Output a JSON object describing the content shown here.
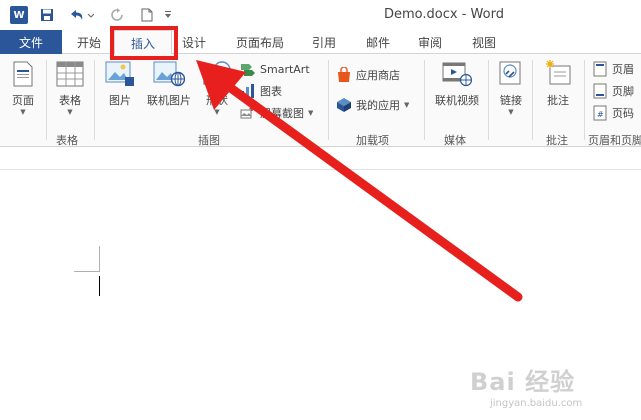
{
  "window": {
    "title": "Demo.docx - Word",
    "app_icon_letter": "W"
  },
  "quick_access": {
    "save": "save-icon",
    "undo": "undo-icon",
    "redo": "redo-icon",
    "new": "new-document-icon",
    "customize": "customize-caret-icon"
  },
  "tabs": {
    "file": "文件",
    "items": [
      "开始",
      "插入",
      "设计",
      "页面布局",
      "引用",
      "邮件",
      "审阅",
      "视图"
    ],
    "active": "插入"
  },
  "ribbon": {
    "groups": {
      "pages": "",
      "tables": "表格",
      "illustrations": "插图",
      "addins": "加载项",
      "media": "媒体",
      "links": "",
      "comments": "批注",
      "header_footer": "页眉和页脚"
    },
    "buttons": {
      "page": "页面",
      "table": "表格",
      "pictures": "图片",
      "online_pictures": "联机图片",
      "shapes": "形状",
      "smartart": "SmartArt",
      "chart": "图表",
      "screenshot": "屏幕截图",
      "store": "应用商店",
      "my_apps": "我的应用",
      "online_video": "联机视频",
      "link": "链接",
      "comment": "批注",
      "header": "页眉",
      "footer": "页脚",
      "page_number": "页码"
    }
  },
  "colors": {
    "word_blue": "#2b579a",
    "annotation_red": "#e8201d"
  },
  "watermark": {
    "main": "Bai 经验",
    "sub": "jingyan.baidu.com"
  }
}
